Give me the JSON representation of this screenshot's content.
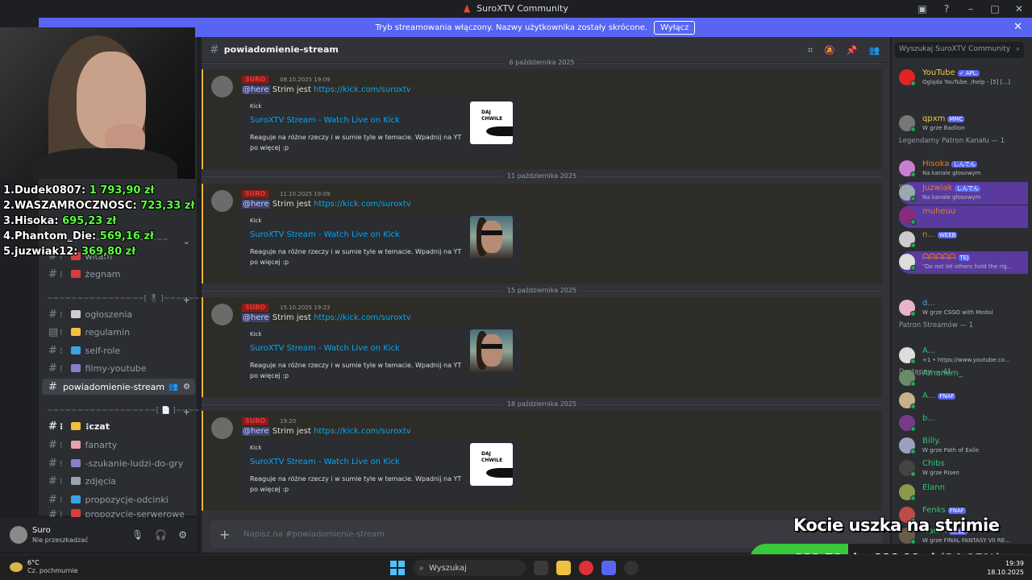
{
  "window": {
    "title": "SuroXTV Community"
  },
  "banner": {
    "text": "Tryb streamowania włączony. Nazwy użytkownika zostały skrócone.",
    "button": "Wyłącz"
  },
  "leaderboard": [
    {
      "rank": "1.",
      "name": "Dudek0807:",
      "amount": "1 793,90 zł"
    },
    {
      "rank": "2.",
      "name": "WASZAMROCZNOSC:",
      "amount": "723,33 zł"
    },
    {
      "rank": "3.",
      "name": "Hisoka:",
      "amount": "695,23 zł"
    },
    {
      "rank": "4.",
      "name": "Phantom_Die:",
      "amount": "569,16 zł"
    },
    {
      "rank": "5.",
      "name": "juzwiak12:",
      "amount": "369,80 zł"
    }
  ],
  "sidebar": {
    "channels": [
      {
        "name": "witam",
        "color": "#d83c3e"
      },
      {
        "name": "żegnam",
        "color": "#d83c3e"
      },
      {
        "name": "ogłoszenia",
        "color": "#cfcfcf"
      },
      {
        "name": "regulamin",
        "color": "#f0c040"
      },
      {
        "name": "self-role",
        "color": "#3ba2e8"
      },
      {
        "name": "filmy-youtube",
        "color": "#8a7fcf"
      },
      {
        "name": "powiadomienie-stream",
        "color": ""
      },
      {
        "name": "czat",
        "color": "#f0c040"
      },
      {
        "name": "fanarty",
        "color": "#e8a0b0"
      },
      {
        "name": "-szukanie-ludzi-do-gry",
        "color": "#8a7fcf"
      },
      {
        "name": "zdjęcia",
        "color": "#9aa4ae"
      },
      {
        "name": "propozycje-odcinki",
        "color": "#3ba2e8"
      },
      {
        "name": "propozycje-serwerowe",
        "color": "#d83c3e"
      }
    ]
  },
  "user": {
    "name": "Suro",
    "status": "Nie przeszkadzać"
  },
  "chat": {
    "channel": "powiadomienie-stream",
    "placeholder": "Napisz na #powiadomienie-stream",
    "dates": [
      "6 października 2025",
      "11 października 2025",
      "15 października 2025",
      "18 października 2025"
    ],
    "author": "SURO",
    "mention": "@here",
    "text": "Strim jest",
    "link": "https://kick.com/suroxtv",
    "messages": [
      {
        "time": "08.10.2025 19:09",
        "thumb": "a"
      },
      {
        "time": "11.10.2025 19:09",
        "thumb": "b"
      },
      {
        "time": "15.10.2025 19:23",
        "thumb": "b"
      },
      {
        "time": "19:20",
        "thumb": "a"
      }
    ],
    "embed": {
      "provider": "Kick",
      "title": "SuroXTV Stream - Watch Live on Kick",
      "description": "Reaguje na różne rzeczy i w sumie tyle w temacie. Wpadnij na YT po więcej :p",
      "thumb_text": "DAJ CHWILE"
    }
  },
  "members": {
    "search_placeholder": "Wyszukaj SuroXTV Community",
    "groups": [
      {
        "label": "Legendarny Patron Kanału — 1"
      },
      {
        "label": "Wierny Patron Kanału — 5"
      },
      {
        "label": "Patron Streamów — 1"
      },
      {
        "label": "Dostępny — 41"
      }
    ],
    "list": [
      {
        "name": "YouTube",
        "tag": "✓ APL.",
        "activity": "Ogląda YouTube. /help - [5] [...]",
        "color": "#f2c94c",
        "av": "#e02424"
      },
      {
        "name": "qpxm",
        "tag": "MMC",
        "activity": "W grze Badlion",
        "color": "#f2c94c",
        "av": "#777"
      },
      {
        "name": "Hisoka",
        "tag": "しんでん",
        "activity": "Na kanale głosowym",
        "color": "#e67e22",
        "av": "#c87fd0"
      },
      {
        "name": "Juzwiak",
        "tag": "しんでん",
        "activity": "Na kanale głosowym",
        "color": "#e67e22",
        "av": "#9aa"
      },
      {
        "name": "muheuu",
        "tag": "",
        "activity": "",
        "color": "#e67e22",
        "av": "#8a2a7a"
      },
      {
        "name": "n...",
        "tag": "WEEB",
        "activity": "",
        "color": "#e67e22",
        "av": "#ccc"
      },
      {
        "name": "ᗩᗩᗩᗩᗩ",
        "tag": "TEJ",
        "activity": "\"Do not let others hold the rig...",
        "color": "#e67e22",
        "av": "#ddd"
      },
      {
        "name": "d...",
        "tag": "",
        "activity": "W grze CSGO with Medal",
        "color": "#3ba2e8",
        "av": "#e8b4c8"
      },
      {
        "name": "A...",
        "tag": "",
        "activity": "+1 • https://www.youtube.co...",
        "color": "#2dc770",
        "av": "#ddd"
      },
      {
        "name": "Amanem_",
        "tag": "",
        "activity": "",
        "color": "#2dc770",
        "av": "#6a8a6a"
      },
      {
        "name": "A...",
        "tag": "FNAF",
        "activity": "",
        "color": "#2dc770",
        "av": "#c9b08a"
      },
      {
        "name": "b...",
        "tag": "",
        "activity": "",
        "color": "#2dc770",
        "av": "#7a3a8a"
      },
      {
        "name": "Billy.",
        "tag": "",
        "activity": "W grze Path of Exile",
        "color": "#2dc770",
        "av": "#9aa0c0"
      },
      {
        "name": "Chibs",
        "tag": "",
        "activity": "W grze Risen",
        "color": "#2dc770",
        "av": "#444"
      },
      {
        "name": "Elann",
        "tag": "",
        "activity": "",
        "color": "#2dc770",
        "av": "#8a9a4a"
      },
      {
        "name": "Fenks",
        "tag": "FNAF",
        "activity": "",
        "color": "#2dc770",
        "av": "#c04a4a"
      },
      {
        "name": "Harmi",
        "tag": "ZELO",
        "activity": "W grze FINAL FANTASY VII RE...",
        "color": "#2dc770",
        "av": "#6a5a4a"
      }
    ]
  },
  "overlay": {
    "title": "Kocie uszka na strimie",
    "goal_current": "232,78 zł",
    "goal_sep": "z",
    "goal_target": "666,00 zł",
    "goal_pct": "(34,95%)",
    "goal_fraction": 0.3495
  },
  "taskbar": {
    "temp": "6°C",
    "weather": "Cz. pochmurnie",
    "search": "Wyszukaj",
    "time": "19:39",
    "date": "18.10.2025"
  }
}
